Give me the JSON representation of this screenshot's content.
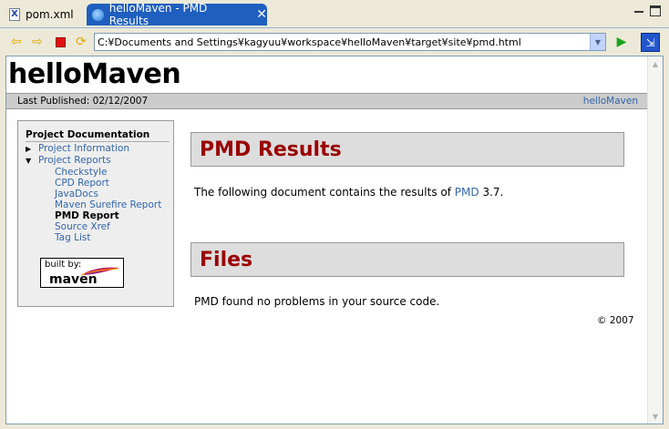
{
  "tabs": [
    {
      "label": "pom.xml",
      "icon": "xml-file-icon",
      "active": false
    },
    {
      "label": "helloMaven - PMD Results",
      "icon": "globe-icon",
      "active": true
    }
  ],
  "toolbar": {
    "url": "C:¥Documents and Settings¥kagyuu¥workspace¥helloMaven¥target¥site¥pmd.html"
  },
  "page": {
    "site_title": "helloMaven",
    "last_published": "Last Published: 02/12/2007",
    "breadcrumb_link": "helloMaven",
    "nav": {
      "heading": "Project Documentation",
      "project_information": "Project Information",
      "project_reports": "Project Reports",
      "reports": [
        "Checkstyle",
        "CPD Report",
        "JavaDocs",
        "Maven Surefire Report",
        "PMD Report",
        "Source Xref",
        "Tag List"
      ],
      "current": "PMD Report"
    },
    "logo": {
      "built_by": "built by:",
      "name": "maven"
    },
    "sections": [
      {
        "title": "PMD Results",
        "text_before": "The following document contains the results of ",
        "link": "PMD",
        "text_after": " 3.7."
      },
      {
        "title": "Files",
        "text": "PMD found no problems in your source code."
      }
    ],
    "copyright": "© 2007"
  },
  "colors": {
    "tab_active": "#1f5fbf",
    "section_title": "#990000",
    "link": "#3366aa"
  }
}
